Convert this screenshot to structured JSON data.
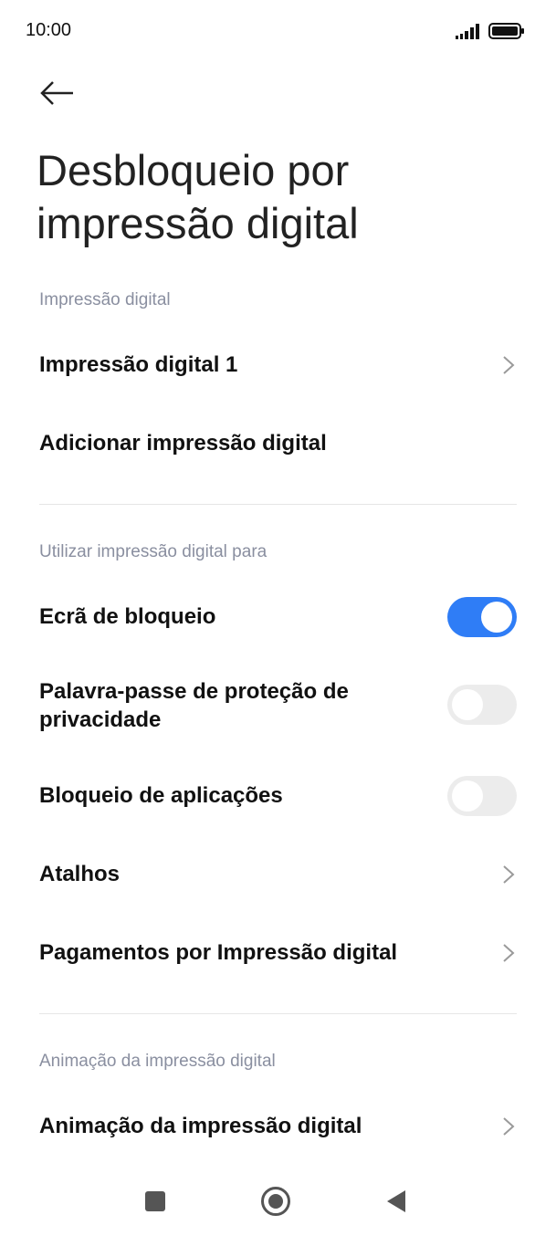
{
  "status_bar": {
    "time": "10:00",
    "signal_icon": "signal-icon",
    "battery_icon": "battery-icon"
  },
  "header": {
    "back_icon": "arrow-left-icon",
    "title": "Desbloqueio por impressão digital"
  },
  "sections": {
    "fingerprints": {
      "header": "Impressão digital",
      "items": [
        {
          "label": "Impressão digital 1"
        },
        {
          "label": "Adicionar impressão digital"
        }
      ]
    },
    "use_for": {
      "header": "Utilizar impressão digital para",
      "items": [
        {
          "label": "Ecrã de bloqueio",
          "enabled": true
        },
        {
          "label": "Palavra-passe de proteção de privacidade",
          "enabled": false
        },
        {
          "label": "Bloqueio de aplicações",
          "enabled": false
        },
        {
          "label": "Atalhos"
        },
        {
          "label": "Pagamentos por Impressão digital"
        }
      ]
    },
    "animation": {
      "header": "Animação da impressão digital",
      "items": [
        {
          "label": "Animação da impressão digital"
        }
      ]
    }
  },
  "colors": {
    "accent": "#2f7df6",
    "toggle_off": "#ececec",
    "section_header": "#8a8fa0"
  },
  "nav_bar": {
    "recents_icon": "square-icon",
    "home_icon": "circle-icon",
    "back_icon": "triangle-back-icon"
  }
}
